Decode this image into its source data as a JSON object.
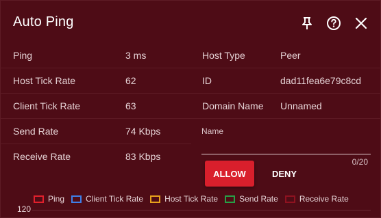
{
  "header": {
    "title": "Auto Ping",
    "icons": [
      "pin-icon",
      "help-icon",
      "close-icon"
    ]
  },
  "stats_left": [
    {
      "label": "Ping",
      "value": "3 ms"
    },
    {
      "label": "Host Tick Rate",
      "value": "62"
    },
    {
      "label": "Client Tick Rate",
      "value": "63"
    },
    {
      "label": "Send Rate",
      "value": "74 Kbps"
    },
    {
      "label": "Receive Rate",
      "value": "83 Kbps"
    }
  ],
  "stats_right": [
    {
      "label": "Host Type",
      "value": "Peer"
    },
    {
      "label": "ID",
      "value": "dad11fea6e79c8cd"
    },
    {
      "label": "Domain Name",
      "value": "Unnamed"
    }
  ],
  "name_field": {
    "label": "Name",
    "value": "",
    "counter": "0/20"
  },
  "actions": {
    "allow_label": "ALLOW",
    "deny_label": "DENY"
  },
  "chart": {
    "legend": [
      {
        "name": "Ping",
        "color": "#e2202c"
      },
      {
        "name": "Client Tick Rate",
        "color": "#3f7fe8"
      },
      {
        "name": "Host Tick Rate",
        "color": "#e8a21c"
      },
      {
        "name": "Send Rate",
        "color": "#27a046"
      },
      {
        "name": "Receive Rate",
        "color": "#8f1220"
      }
    ],
    "y_tick": "120"
  }
}
